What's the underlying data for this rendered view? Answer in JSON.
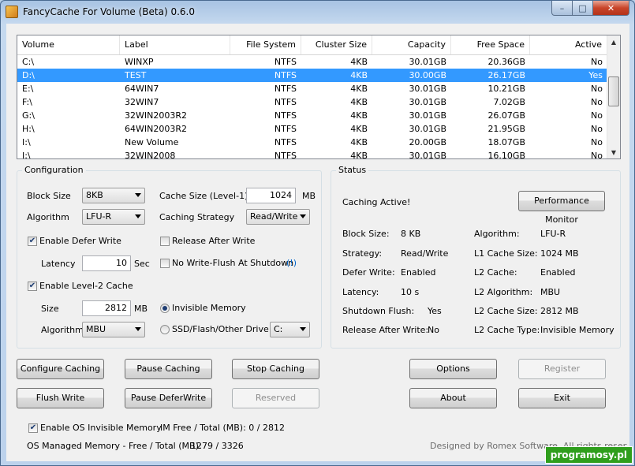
{
  "window": {
    "title": "FancyCache For Volume (Beta) 0.6.0",
    "controls": {
      "minimize": "–",
      "maximize": "□",
      "close": "✕"
    }
  },
  "volumes": {
    "headers": [
      "Volume",
      "Label",
      "File System",
      "Cluster Size",
      "Capacity",
      "Free Space",
      "Active"
    ],
    "rows": [
      [
        "C:\\",
        "WINXP",
        "NTFS",
        "4KB",
        "30.01GB",
        "20.36GB",
        "No"
      ],
      [
        "D:\\",
        "TEST",
        "NTFS",
        "4KB",
        "30.00GB",
        "26.17GB",
        "Yes"
      ],
      [
        "E:\\",
        "64WIN7",
        "NTFS",
        "4KB",
        "30.01GB",
        "10.21GB",
        "No"
      ],
      [
        "F:\\",
        "32WIN7",
        "NTFS",
        "4KB",
        "30.01GB",
        "7.02GB",
        "No"
      ],
      [
        "G:\\",
        "32WIN2003R2",
        "NTFS",
        "4KB",
        "30.01GB",
        "26.07GB",
        "No"
      ],
      [
        "H:\\",
        "64WIN2003R2",
        "NTFS",
        "4KB",
        "30.01GB",
        "21.95GB",
        "No"
      ],
      [
        "I:\\",
        "New Volume",
        "NTFS",
        "4KB",
        "20.00GB",
        "18.07GB",
        "No"
      ],
      [
        "J:\\",
        "32WIN2008",
        "NTFS",
        "4KB",
        "30.01GB",
        "16.10GB",
        "No"
      ]
    ]
  },
  "config": {
    "title": "Configuration",
    "block_size_label": "Block Size",
    "block_size_value": "8KB",
    "algorithm_label": "Algorithm",
    "algorithm_value": "LFU-R",
    "cache_size_label": "Cache Size (Level-1)",
    "cache_size_value": "1024",
    "cache_size_unit": "MB",
    "caching_strategy_label": "Caching Strategy",
    "caching_strategy_value": "Read/Write",
    "enable_defer_write": "Enable Defer Write",
    "release_after_write": "Release After Write",
    "latency_label": "Latency",
    "latency_value": "10",
    "latency_unit": "Sec",
    "no_write_flush": "No Write-Flush At Shutdown",
    "no_write_flush_hint": "(!)",
    "enable_level2": "Enable Level-2 Cache",
    "l2_size_label": "Size",
    "l2_size_value": "2812",
    "l2_size_unit": "MB",
    "invisible_memory": "Invisible Memory",
    "l2_algorithm_label": "Algorithm",
    "l2_algorithm_value": "MBU",
    "ssd_flash": "SSD/Flash/Other Drive",
    "drive_value": "C:"
  },
  "status": {
    "title": "Status",
    "caching_active": "Caching Active!",
    "perf_button": "Performance Monitor",
    "left": [
      [
        "Block Size:",
        "8 KB"
      ],
      [
        "Strategy:",
        "Read/Write"
      ],
      [
        "Defer Write:",
        "Enabled"
      ],
      [
        "Latency:",
        "10 s"
      ],
      [
        "Shutdown Flush:",
        "Yes"
      ],
      [
        "Release After Write:",
        "No"
      ]
    ],
    "right": [
      [
        "Algorithm:",
        "LFU-R"
      ],
      [
        "L1 Cache Size:",
        "1024 MB"
      ],
      [
        "L2 Cache:",
        "Enabled"
      ],
      [
        "L2 Algorithm:",
        "MBU"
      ],
      [
        "L2 Cache Size:",
        "2812 MB"
      ],
      [
        "L2 Cache Type:",
        "Invisible Memory"
      ]
    ]
  },
  "buttons": {
    "configure_caching": "Configure Caching",
    "pause_caching": "Pause Caching",
    "stop_caching": "Stop Caching",
    "options": "Options",
    "register": "Register",
    "flush_write": "Flush Write",
    "pause_deferwrite": "Pause DeferWrite",
    "reserved": "Reserved",
    "about": "About",
    "exit": "Exit"
  },
  "footer": {
    "enable_os_invisible": "Enable OS Invisible Memory",
    "im_free_total": "IM Free / Total (MB): 0 / 2812",
    "os_managed_label": "OS Managed Memory - Free / Total (MB):",
    "os_managed_value": "1279 / 3326",
    "designed_by": "Designed by Romex Software. All rights reserved.",
    "watermark": "programosy.pl"
  }
}
